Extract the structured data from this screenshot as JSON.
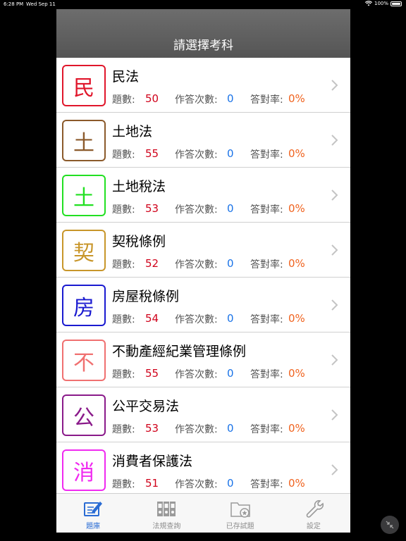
{
  "status_bar": {
    "time": "6:28 PM",
    "date": "Wed Sep 11",
    "battery": "100%"
  },
  "nav": {
    "title": "請選擇考科"
  },
  "labels": {
    "question_count": "題數:",
    "attempts": "作答次數:",
    "correct_rate": "答對率:"
  },
  "subjects": [
    {
      "icon_char": "民",
      "name": "民法",
      "questions": "50",
      "attempts": "0",
      "rate": "0%",
      "color": "#e0162b"
    },
    {
      "icon_char": "土",
      "name": "土地法",
      "questions": "55",
      "attempts": "0",
      "rate": "0%",
      "color": "#8b5a2b"
    },
    {
      "icon_char": "土",
      "name": "土地稅法",
      "questions": "53",
      "attempts": "0",
      "rate": "0%",
      "color": "#22e022"
    },
    {
      "icon_char": "契",
      "name": "契稅條例",
      "questions": "52",
      "attempts": "0",
      "rate": "0%",
      "color": "#c8962a"
    },
    {
      "icon_char": "房",
      "name": "房屋稅條例",
      "questions": "54",
      "attempts": "0",
      "rate": "0%",
      "color": "#1a1ad0"
    },
    {
      "icon_char": "不",
      "name": "不動產經紀業管理條例",
      "questions": "55",
      "attempts": "0",
      "rate": "0%",
      "color": "#f07070"
    },
    {
      "icon_char": "公",
      "name": "公平交易法",
      "questions": "53",
      "attempts": "0",
      "rate": "0%",
      "color": "#8a1a8a"
    },
    {
      "icon_char": "消",
      "name": "消費者保護法",
      "questions": "51",
      "attempts": "0",
      "rate": "0%",
      "color": "#f02af0"
    }
  ],
  "tabs": [
    {
      "label": "題庫",
      "icon": "edit-icon",
      "active": true
    },
    {
      "label": "法規查詢",
      "icon": "binders-icon",
      "active": false
    },
    {
      "label": "已存試題",
      "icon": "saved-folder-icon",
      "active": false
    },
    {
      "label": "設定",
      "icon": "wrench-icon",
      "active": false
    }
  ]
}
